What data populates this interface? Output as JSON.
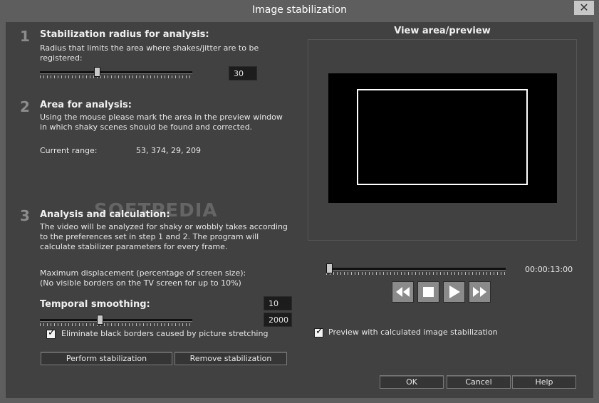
{
  "window": {
    "title": "Image stabilization",
    "close_glyph": "✕"
  },
  "step1": {
    "number": "1",
    "heading": "Stabilization radius for analysis:",
    "description": "Radius that limits the area where shakes/jitter are to be registered:",
    "radius_value": "30",
    "slider_level": 0.37
  },
  "step2": {
    "number": "2",
    "heading": "Area for analysis:",
    "description": "Using the mouse please mark the area in the preview window in which shaky scenes should be found and corrected.",
    "range_label": "Current range:",
    "range_value": "53, 374, 29, 209"
  },
  "watermark": "SOFTPEDIA",
  "step3": {
    "number": "3",
    "heading": "Analysis and calculation:",
    "description": "The video will be analyzed for shaky or wobbly takes according to the preferences set in step 1 and 2. The program will calculate stabilizer parameters for every frame.",
    "displacement_line1": "Maximum displacement (percentage of screen size):",
    "displacement_line2": "(No visible borders on the TV screen for up to 10%)",
    "displacement_value": "10",
    "smoothing_heading": "Temporal smoothing:",
    "smoothing_value": "2000",
    "smoothing_level": 0.39,
    "eliminate_label": "Eliminate black borders caused by picture stretching",
    "eliminate_checked": true,
    "perform_button": "Perform stabilization",
    "remove_button": "Remove stabilization"
  },
  "preview": {
    "heading": "View area/preview",
    "timecode": "00:00:13:00",
    "position_level": 0.0,
    "checkbox_label": "Preview with calculated image stabilization",
    "checkbox_checked": true
  },
  "dialog": {
    "ok": "OK",
    "cancel": "Cancel",
    "help": "Help"
  }
}
